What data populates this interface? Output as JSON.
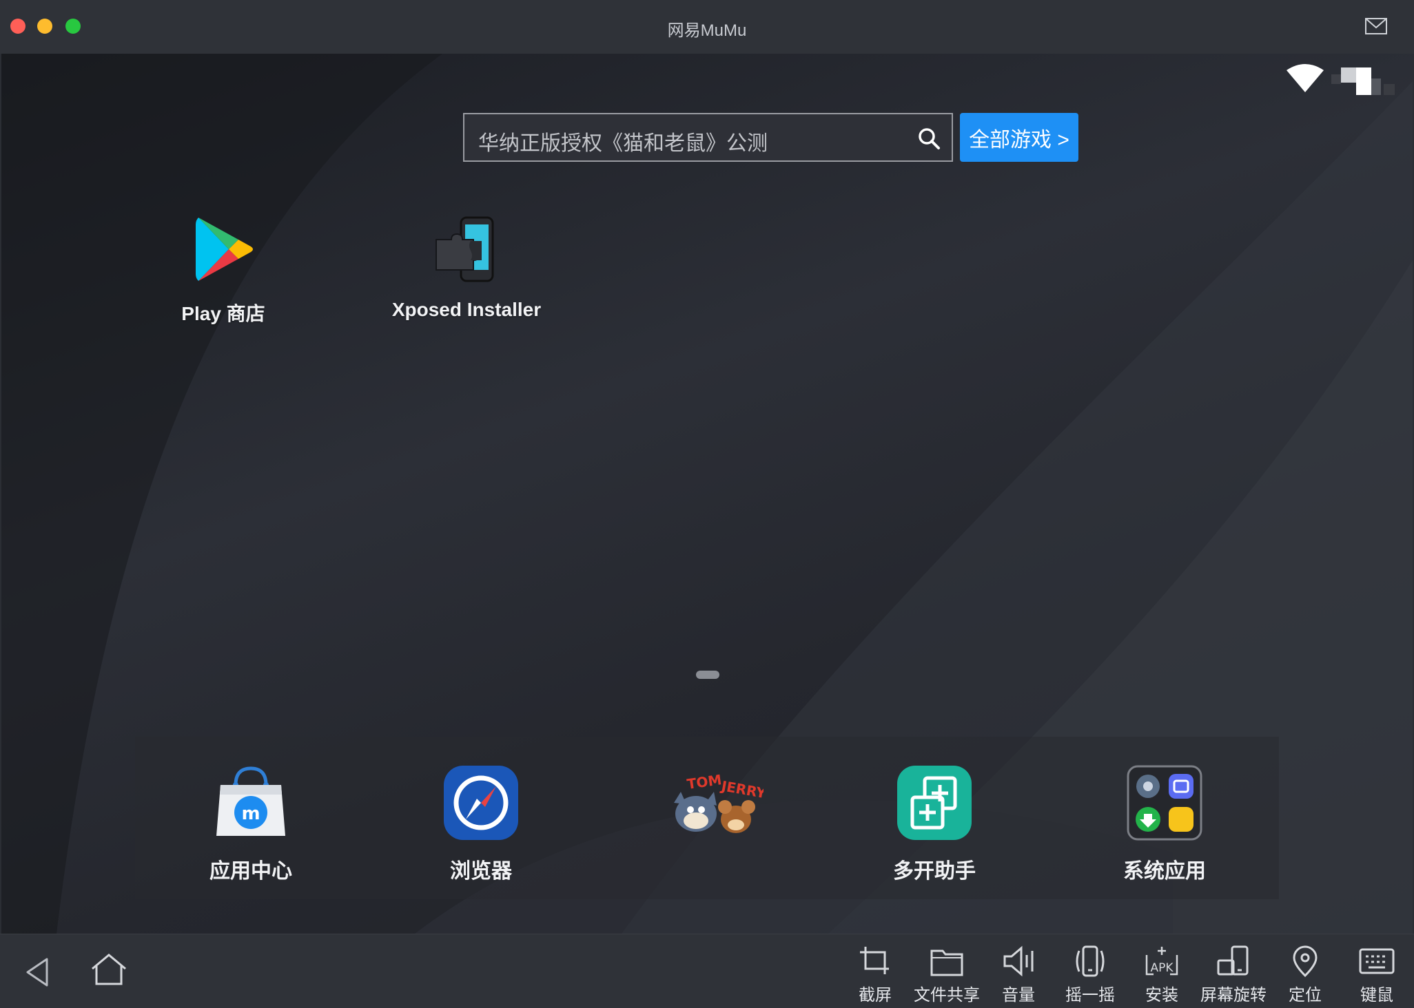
{
  "window": {
    "title": "网易MuMu"
  },
  "search": {
    "text": "华纳正版授权《猫和老鼠》公测",
    "all_games_label": "全部游戏 >"
  },
  "apps": [
    {
      "label": "Play 商店",
      "icon": "play-store-icon"
    },
    {
      "label": "Xposed Installer",
      "icon": "xposed-icon"
    }
  ],
  "dock": [
    {
      "label": "应用中心",
      "icon": "app-center-icon"
    },
    {
      "label": "浏览器",
      "icon": "browser-icon"
    },
    {
      "label": "",
      "icon": "tom-and-jerry-icon"
    },
    {
      "label": "多开助手",
      "icon": "multi-instance-icon"
    },
    {
      "label": "系统应用",
      "icon": "system-apps-icon"
    }
  ],
  "toolbar": {
    "items": [
      {
        "label": "截屏",
        "icon": "crop-icon"
      },
      {
        "label": "文件共享",
        "icon": "folder-icon"
      },
      {
        "label": "音量",
        "icon": "volume-icon"
      },
      {
        "label": "摇一摇",
        "icon": "shake-icon"
      },
      {
        "label": "安装",
        "icon": "apk-install-icon"
      },
      {
        "label": "屏幕旋转",
        "icon": "rotate-screen-icon"
      },
      {
        "label": "定位",
        "icon": "location-icon"
      },
      {
        "label": "键鼠",
        "icon": "keyboard-icon"
      }
    ]
  },
  "colors": {
    "accent": "#1e90f5",
    "titlebar": "#2f3238"
  }
}
